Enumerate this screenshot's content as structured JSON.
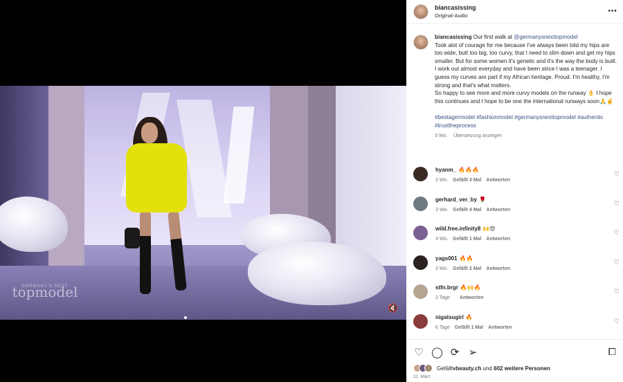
{
  "post": {
    "username": "biancasissing",
    "audio": "Original-Audio",
    "more_icon": "⋯"
  },
  "caption": {
    "username": "biancasissing",
    "intro": "Our first walk at ",
    "mention": "@germanysnexttopmodel",
    "body": "Took alot of courage for me because I've always been told my hips are too wide, butt too big, too curvy, that I need to slim down and get my hips smaller. But for some women it's genetic and it's the way the body is built. I work out almost everyday and have been since I was a teenager. I guess my curves are part if my African heritage. Proud. I'm healthy, I'm strong and that's what matters.",
    "body2": "So happy to see more and more curvy models on the runway 👌 I hope this continues and I hope to be one the international runways soon🙏✌️",
    "hashtags": "#bestagermodel #fashionmodel #germanysnexttopmodel #authentic #trusttheprocess",
    "age": "3 Wo.",
    "translate": "Übersetzung anzeigen"
  },
  "comments": [
    {
      "user": "hyanm_",
      "text": "🔥🔥🔥",
      "age": "3 Wo.",
      "likes": "Gefällt 3 Mal",
      "reply": "Antworten",
      "color": "#3a2a24"
    },
    {
      "user": "gerhard_ver_by",
      "text": "🌹",
      "age": "3 Wo.",
      "likes": "Gefällt 4 Mal",
      "reply": "Antworten",
      "color": "#6d7b7f"
    },
    {
      "user": "wild.free.infinity8",
      "text": "🙌😍",
      "age": "3 Wo.",
      "likes": "Gefällt 1 Mal",
      "reply": "Antworten",
      "color": "#7a5f93"
    },
    {
      "user": "yags001",
      "text": "🔥🔥",
      "age": "3 Wo.",
      "likes": "Gefällt 2 Mal",
      "reply": "Antworten",
      "color": "#2b2222"
    },
    {
      "user": "stfn.brgr",
      "text": "🔥🙌🔥",
      "age": "2 Tage",
      "likes": "",
      "reply": "Antworten",
      "color": "#b5a591"
    },
    {
      "user": "nigatsugirl",
      "text": "🔥",
      "age": "6 Tage",
      "likes": "Gefällt 1 Mal",
      "reply": "Antworten",
      "color": "#8a3c3c"
    }
  ],
  "actions": {
    "like_icon": "♡",
    "comment_icon": "◯",
    "share_icon": "⟳",
    "send_icon": "➢",
    "save_icon": "⧠"
  },
  "likes": {
    "prefix": "Gefällt ",
    "user": "vbeauty.ch",
    "middle": " und ",
    "count": "602 weitere Personen"
  },
  "date": "11. März",
  "video": {
    "logo_small": "GERMANY'S NEXT",
    "logo": "topmodel",
    "mute_icon": "🔇"
  },
  "colors": {
    "link": "#385185",
    "hoodie": "#e3e00b"
  }
}
